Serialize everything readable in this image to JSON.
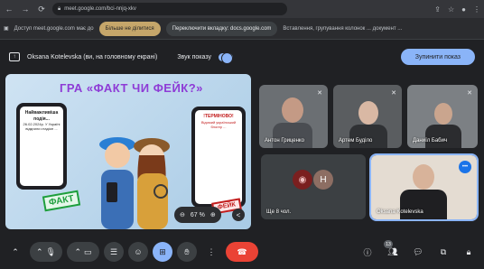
{
  "browser": {
    "url": "meet.google.com/bci-nnjq-xkv",
    "icons": [
      "back-icon",
      "forward-icon",
      "reload-icon",
      "share-icon",
      "bookmark-star-icon",
      "profile-icon",
      "menu-icon"
    ]
  },
  "infobar": {
    "text": "Доступ meet.google.com має до",
    "stop_label": "Більше не ділитися",
    "switch_label": "Переключити вкладку: docs.google.com",
    "tab_text": "Вставлення, групування колонок ... документ ..."
  },
  "banner": {
    "presenter_text": "Oksana Kotelevska (ви, на головному екрані)",
    "sound_label": "Звук показу",
    "stop_presenting_label": "Зупинити показ"
  },
  "presentation": {
    "title": "ГРА «ФАКТ ЧИ ФЕЙК?»",
    "left_phone_head": "Найважливіша подія...",
    "left_phone_text": "26.02.2024р. У Україні відкрили стадіон ...",
    "right_phone_head": "!ТЕРМІНОВО!",
    "right_phone_text": "Відомий український блогер ...",
    "stamp_fact": "ФАКТ",
    "stamp_fake": "ФЕЙК",
    "zoom_value": "67 %"
  },
  "participants": [
    {
      "name": "Антон Гриценко",
      "muted": true
    },
    {
      "name": "Артем Буділо",
      "muted": true
    },
    {
      "name": "Даниїл Бабич",
      "muted": true
    },
    {
      "name": "Ще 8 чол.",
      "initial": "H"
    },
    {
      "name": "Oksana Kotelevska",
      "speaking": true
    }
  ],
  "controls": {
    "people_count": "13"
  },
  "colors": {
    "accent": "#8ab4f8",
    "end_call": "#ea4335",
    "background": "#202124"
  }
}
